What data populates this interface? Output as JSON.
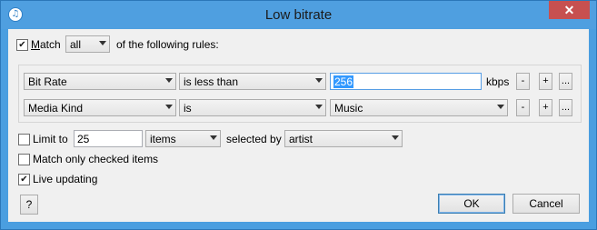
{
  "window": {
    "title": "Low bitrate",
    "close_glyph": "✕",
    "app_icon_glyph": "♫"
  },
  "match": {
    "checked": true,
    "label": "Match",
    "scope_value": "all",
    "suffix": "of the following rules:"
  },
  "rules": [
    {
      "field": "Bit Rate",
      "operator": "is less than",
      "value": "256",
      "unit": "kbps",
      "remove_label": "-",
      "add_label": "+",
      "more_label": "..."
    },
    {
      "field": "Media Kind",
      "operator": "is",
      "value": "Music",
      "remove_label": "-",
      "add_label": "+",
      "more_label": "..."
    }
  ],
  "limit": {
    "checked": false,
    "label": "Limit to",
    "count": "25",
    "unit": "items",
    "selected_by_label": "selected by",
    "selected_by_value": "artist"
  },
  "match_checked_only": {
    "checked": false,
    "label": "Match only checked items"
  },
  "live_updating": {
    "checked": true,
    "label": "Live updating"
  },
  "buttons": {
    "help": "?",
    "ok": "OK",
    "cancel": "Cancel"
  }
}
